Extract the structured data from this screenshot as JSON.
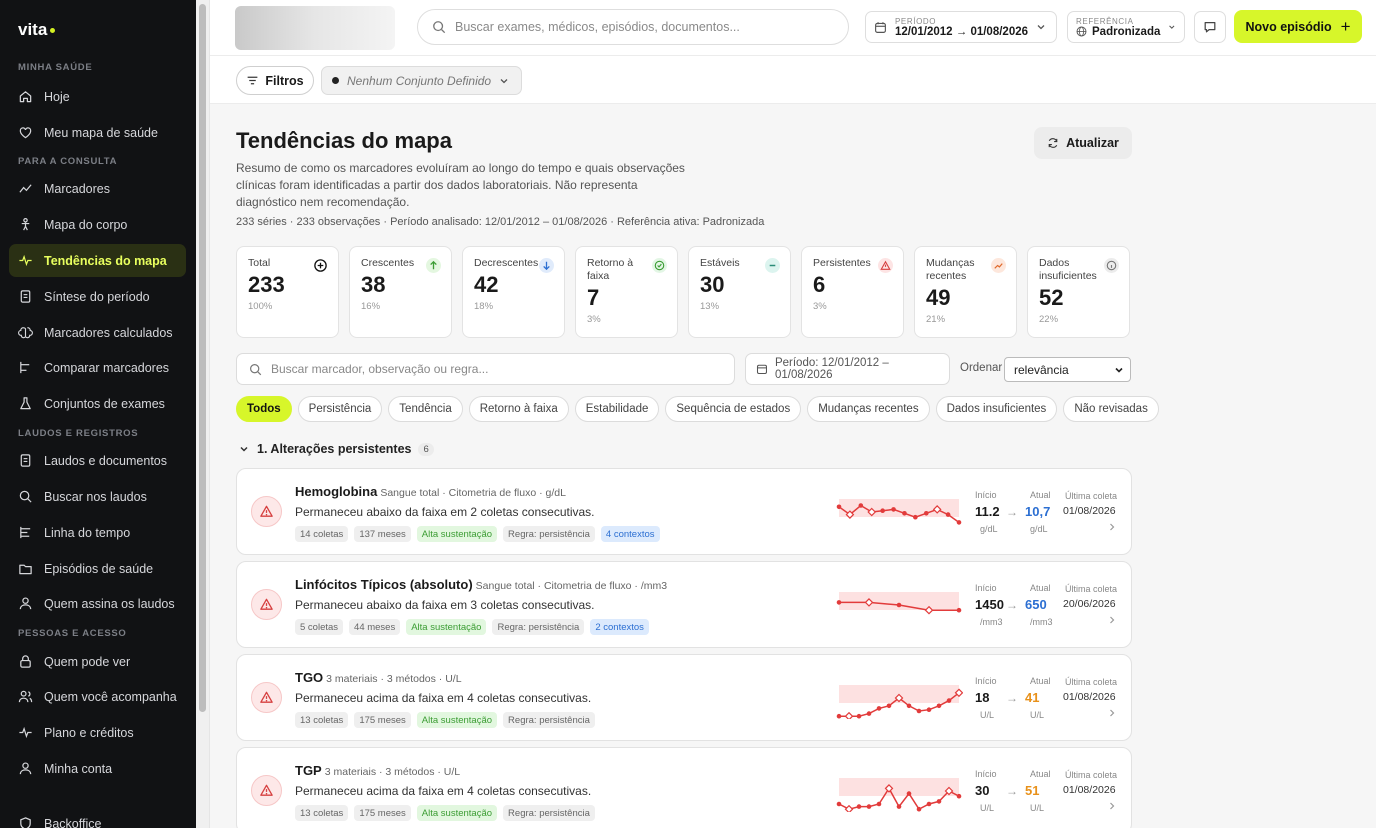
{
  "sidebar": {
    "brand": "vita",
    "sections": [
      "MINHA SAÚDE",
      "PARA A CONSULTA",
      "LAUDOS E REGISTROS",
      "PESSOAS E ACESSO"
    ],
    "items": [
      {
        "label": "Hoje",
        "icon": "home-icon"
      },
      {
        "label": "Meu mapa de saúde",
        "icon": "heart-icon"
      },
      {
        "label": "Marcadores",
        "icon": "trend-icon"
      },
      {
        "label": "Mapa do corpo",
        "icon": "body-icon"
      },
      {
        "label": "Tendências do mapa",
        "icon": "pulse-icon",
        "active": true
      },
      {
        "label": "Síntese do período",
        "icon": "document-icon"
      },
      {
        "label": "Marcadores calculados",
        "icon": "brain-icon"
      },
      {
        "label": "Comparar marcadores",
        "icon": "compare-icon"
      },
      {
        "label": "Conjuntos de exames",
        "icon": "flask-icon"
      },
      {
        "label": "Laudos e documentos",
        "icon": "document-icon"
      },
      {
        "label": "Buscar nos laudos",
        "icon": "search-icon"
      },
      {
        "label": "Linha do tempo",
        "icon": "timeline-icon"
      },
      {
        "label": "Episódios de saúde",
        "icon": "folder-icon"
      },
      {
        "label": "Quem assina os laudos",
        "icon": "user-icon"
      },
      {
        "label": "Quem pode ver",
        "icon": "lock-icon"
      },
      {
        "label": "Quem você acompanha",
        "icon": "users-icon"
      },
      {
        "label": "Plano e créditos",
        "icon": "pulse-icon"
      },
      {
        "label": "Minha conta",
        "icon": "user-icon"
      },
      {
        "label": "Backoffice",
        "icon": "shield-icon"
      }
    ]
  },
  "topbar": {
    "search_placeholder": "Buscar exames, médicos, episódios, documentos...",
    "period_label": "PERÍODO",
    "period_value": "12/01/2012 → 01/08/2026",
    "reference_label": "REFERÊNCIA",
    "reference_value": "Padronizada",
    "new_episode": "Novo episódio"
  },
  "filters": {
    "button": "Filtros",
    "set_label": "Nenhum Conjunto Definido"
  },
  "page": {
    "title": "Tendências do mapa",
    "refresh": "Atualizar",
    "description": "Resumo de como os marcadores evoluíram ao longo do tempo e quais observações clínicas foram identificadas a partir dos dados laboratoriais. Não representa diagnóstico nem recomendação.",
    "meta": "233 séries · 233 observações · Período analisado: 12/01/2012 – 01/08/2026 · Referência ativa: Padronizada"
  },
  "stats": [
    {
      "label": "Total",
      "value": "233",
      "pct": "100%",
      "icon": "plus-circle-icon",
      "color": "#ffffff"
    },
    {
      "label": "Crescentes",
      "value": "38",
      "pct": "16%",
      "icon": "arrow-up-icon",
      "color": "#e4f7e0"
    },
    {
      "label": "Decrescentes",
      "value": "42",
      "pct": "18%",
      "icon": "arrow-down-icon",
      "color": "#e0ebfb"
    },
    {
      "label": "Retorno à faixa",
      "value": "7",
      "pct": "3%",
      "icon": "check-circle-icon",
      "color": "#e3f6e5"
    },
    {
      "label": "Estáveis",
      "value": "30",
      "pct": "13%",
      "icon": "minus-icon",
      "color": "#dcf4ef"
    },
    {
      "label": "Persistentes",
      "value": "6",
      "pct": "3%",
      "icon": "warning-icon",
      "color": "#fde4e4"
    },
    {
      "label": "Mudanças recentes",
      "value": "49",
      "pct": "21%",
      "icon": "trend-up-icon",
      "color": "#fde7dc"
    },
    {
      "label": "Dados insuficientes",
      "value": "52",
      "pct": "22%",
      "icon": "info-icon",
      "color": "#ececec"
    }
  ],
  "toolbar": {
    "search_placeholder": "Buscar marcador, observação ou regra...",
    "period": "Período: 12/01/2012 – 01/08/2026",
    "order_label": "Ordenar",
    "order_value": "relevância"
  },
  "tabs": [
    "Todos",
    "Persistência",
    "Tendência",
    "Retorno à faixa",
    "Estabilidade",
    "Sequência de estados",
    "Mudanças recentes",
    "Dados insuficientes",
    "Não revisadas"
  ],
  "group": {
    "title": "1. Alterações persistentes",
    "count": "6"
  },
  "cards": [
    {
      "name": "Hemoglobina",
      "sub": "Sangue total · Citometria de fluxo · g/dL",
      "desc": "Permaneceu abaixo da faixa em 2 coletas consecutivas.",
      "chips": [
        {
          "t": "14 coletas"
        },
        {
          "t": "137 meses"
        },
        {
          "t": "Alta sustentação",
          "k": "g"
        },
        {
          "t": "Regra: persistência"
        },
        {
          "t": "4 contextos",
          "k": "b"
        }
      ],
      "start_label": "Início",
      "start": "11.2",
      "start_unit": "g/dL",
      "cur_label": "Atual",
      "cur": "10,7",
      "cur_unit": "g/dL",
      "cur_color": "#2c6fd2",
      "last_label": "Última coleta",
      "last": "01/08/2026",
      "spark": [
        6,
        12,
        5,
        10,
        9,
        8,
        11,
        14,
        11,
        8,
        12,
        18
      ],
      "diamonds": [
        1,
        3,
        9
      ]
    },
    {
      "name": "Linfócitos Típicos (absoluto)",
      "sub": "Sangue total · Citometria de fluxo · /mm3",
      "desc": "Permaneceu abaixo da faixa em 3 coletas consecutivas.",
      "chips": [
        {
          "t": "5 coletas"
        },
        {
          "t": "44 meses"
        },
        {
          "t": "Alta sustentação",
          "k": "g"
        },
        {
          "t": "Regra: persistência"
        },
        {
          "t": "2 contextos",
          "k": "b"
        }
      ],
      "start_label": "Início",
      "start": "1450",
      "start_unit": "/mm3",
      "cur_label": "Atual",
      "cur": "650",
      "cur_unit": "/mm3",
      "cur_color": "#2c6fd2",
      "last_label": "Última coleta",
      "last": "20/06/2026",
      "spark": [
        8,
        8,
        10,
        14,
        14
      ],
      "diamonds": [
        1,
        3
      ]
    },
    {
      "name": "TGO",
      "sub": "3 materiais · 3 métodos · U/L",
      "desc": "Permaneceu acima da faixa em 4 coletas consecutivas.",
      "chips": [
        {
          "t": "13 coletas"
        },
        {
          "t": "175 meses"
        },
        {
          "t": "Alta sustentação",
          "k": "g"
        },
        {
          "t": "Regra: persistência"
        }
      ],
      "start_label": "Início",
      "start": "18",
      "start_unit": "U/L",
      "cur_label": "Atual",
      "cur": "41",
      "cur_unit": "U/L",
      "cur_color": "#e8911a",
      "last_label": "Última coleta",
      "last": "01/08/2026",
      "spark": [
        24,
        24,
        24,
        22,
        18,
        16,
        10,
        16,
        20,
        19,
        16,
        12,
        6
      ],
      "diamonds": [
        1,
        6,
        12
      ]
    },
    {
      "name": "TGP",
      "sub": "3 materiais · 3 métodos · U/L",
      "desc": "Permaneceu acima da faixa em 4 coletas consecutivas.",
      "chips": [
        {
          "t": "13 coletas"
        },
        {
          "t": "175 meses"
        },
        {
          "t": "Alta sustentação",
          "k": "g"
        },
        {
          "t": "Regra: persistência"
        }
      ],
      "start_label": "Início",
      "start": "30",
      "start_unit": "U/L",
      "cur_label": "Atual",
      "cur": "51",
      "cur_unit": "U/L",
      "cur_color": "#e8911a",
      "last_label": "Última coleta",
      "last": "01/08/2026",
      "spark": [
        20,
        24,
        22,
        22,
        20,
        8,
        22,
        12,
        24,
        20,
        18,
        10,
        14
      ],
      "diamonds": [
        1,
        5,
        11
      ]
    }
  ]
}
